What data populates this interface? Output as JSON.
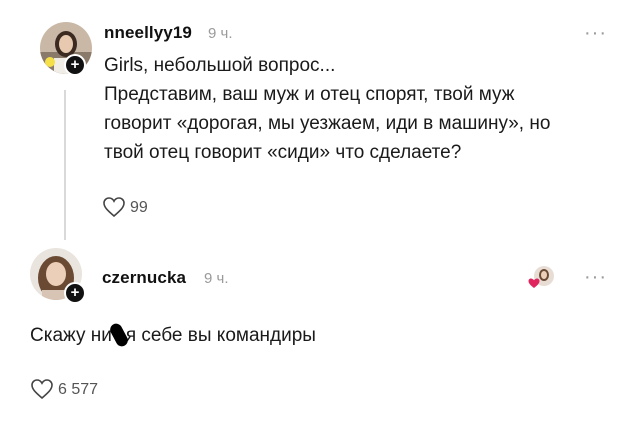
{
  "post": {
    "username": "nneellyy19",
    "time": "9 ч.",
    "more_label": "···",
    "lines": [
      "Girls, небольшой вопрос...",
      "Представим, ваш муж и отец спорят, твой муж",
      "говорит «дорогая, мы уезжаем, иди в машину», но",
      "твой отец говорит «сиди» что сделаете?"
    ],
    "likes": "99",
    "icons": [
      "avatar",
      "follow-plus-icon",
      "heart-icon",
      "more-icon"
    ]
  },
  "reply": {
    "username": "czernucka",
    "time": "9 ч.",
    "more_label": "···",
    "text_before": "Скажу ни",
    "text_after": "я себе вы командиры",
    "likes": "6 577",
    "icons": [
      "avatar",
      "follow-plus-icon",
      "author-liked-icon",
      "heart-icon",
      "more-icon"
    ]
  },
  "colors": {
    "text": "#1a1a1a",
    "muted": "#9a9a9a",
    "line": "#d9d9d9",
    "heart_red": "#e0245e"
  }
}
